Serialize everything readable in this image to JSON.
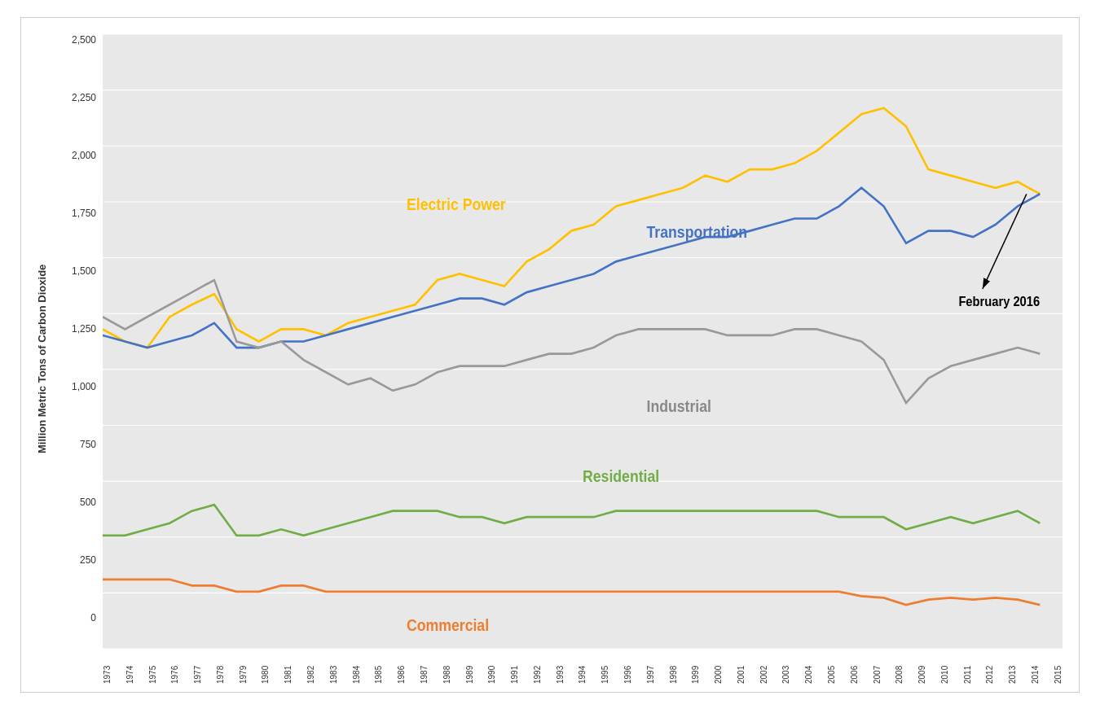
{
  "chart": {
    "title": "",
    "y_axis_label": "Million Metric Tons of Carbon Dioxide",
    "y_ticks": [
      "2,500",
      "2,250",
      "2,000",
      "1,750",
      "1,500",
      "1,250",
      "1,000",
      "750",
      "500",
      "250",
      "0"
    ],
    "x_ticks": [
      "1973",
      "1974",
      "1975",
      "1976",
      "1977",
      "1978",
      "1979",
      "1980",
      "1981",
      "1982",
      "1983",
      "1984",
      "1985",
      "1986",
      "1987",
      "1988",
      "1989",
      "1990",
      "1991",
      "1992",
      "1993",
      "1994",
      "1995",
      "1996",
      "1997",
      "1998",
      "1999",
      "2000",
      "2001",
      "2002",
      "2003",
      "2004",
      "2005",
      "2006",
      "2007",
      "2008",
      "2009",
      "2010",
      "2011",
      "2012",
      "2013",
      "2014",
      "2015"
    ],
    "series": {
      "electric_power": {
        "label": "Electric Power",
        "color": "#FFC000"
      },
      "transportation": {
        "label": "Transportation",
        "color": "#4472C4"
      },
      "industrial": {
        "label": "Industrial",
        "color": "#999999"
      },
      "residential": {
        "label": "Residential",
        "color": "#70AD47"
      },
      "commercial": {
        "label": "Commercial",
        "color": "#ED7D31"
      }
    },
    "annotation": {
      "label": "February 2016",
      "color": "#000"
    }
  }
}
